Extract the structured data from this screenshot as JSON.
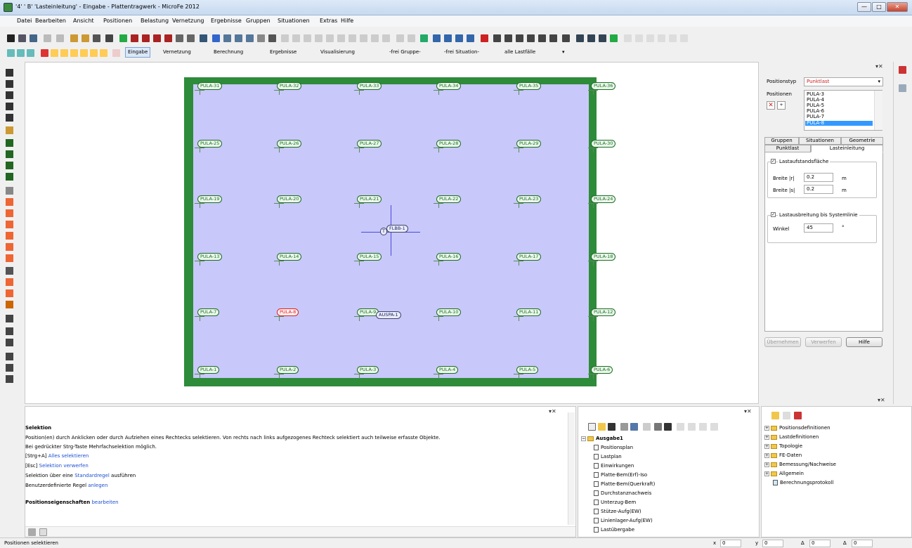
{
  "window": {
    "title": "'4' ' B' 'Lasteinleitung' - Eingabe - Plattentragwerk - MicroFe 2012",
    "min": "—",
    "max": "□",
    "close": "✕"
  },
  "menu": [
    "Datei",
    "Bearbeiten",
    "Ansicht",
    "Positionen",
    "Belastung",
    "Vernetzung",
    "Ergebnisse",
    "Gruppen",
    "Situationen",
    "Extras",
    "Hilfe"
  ],
  "toolbar3": {
    "eingabe": "Eingabe",
    "vernetzung": "Vernetzung",
    "berechnung": "Berechnung",
    "ergebnisse": "Ergebnisse",
    "visualisierung": "Visualisierung",
    "gruppe": "-frei Gruppe-",
    "situation": "-frei Situation-",
    "lastfaelle": "alle Lastfälle"
  },
  "pula": {
    "r1": [
      "PULA-31",
      "PULA-32",
      "PULA-33",
      "PULA-34",
      "PULA-35",
      "PULA-36"
    ],
    "r2": [
      "PULA-25",
      "PULA-26",
      "PULA-27",
      "PULA-28",
      "PULA-29",
      "PULA-30"
    ],
    "r3": [
      "PULA-19",
      "PULA-20",
      "PULA-21",
      "PULA-22",
      "PULA-23",
      "PULA-24"
    ],
    "r4": [
      "PULA-13",
      "PULA-14",
      "PULA-15",
      "PULA-16",
      "PULA-17",
      "PULA-18"
    ],
    "r5": [
      "PULA-7",
      "PULA-8",
      "PULA-9",
      "PULA-10",
      "PULA-11",
      "PULA-12"
    ],
    "r6": [
      "PULA-1",
      "PULA-2",
      "PULA-3",
      "PULA-4",
      "PULA-5",
      "PULA-6"
    ],
    "flbb": "FLBB-1",
    "aussp": "AUSPA-1",
    "sel_marker": "T"
  },
  "props": {
    "positionstyp_label": "Positionstyp",
    "positionstyp_value": "Punktlast",
    "positionen_label": "Positionen",
    "list": [
      "PULA-3",
      "PULA-4",
      "PULA-5",
      "PULA-6",
      "PULA-7",
      "PULA-8"
    ],
    "tabs_top": [
      "Gruppen",
      "Situationen",
      "Geometrie"
    ],
    "tabs_bottom": [
      "Punktlast",
      "Lasteinleitung"
    ],
    "lastaufstand": "Lastaufstandsfläche",
    "breite_r_label": "Breite |r|",
    "breite_r_value": "0.2",
    "breite_s_label": "Breite |s|",
    "breite_s_value": "0.2",
    "unit_m": "m",
    "lastausbreitung": "Lastausbreitung bis Systemlinie",
    "winkel_label": "Winkel",
    "winkel_value": "45",
    "unit_deg": "°",
    "uebernehmen": "Übernehmen",
    "verwerfen": "Verwerfen",
    "hilfe": "Hilfe"
  },
  "selection": {
    "title": "Selektion",
    "line1": "Position(en) durch Anklicken oder durch Aufziehen eines Rechtecks selektieren. Von rechts nach links aufgezogenes Rechteck selektiert auch teilweise erfasste Objekte.",
    "line2": "Bei gedrückter Strg-Taste Mehrfachselektion möglich.",
    "line3_pre": "[Strg+A]",
    "line3_link": "Alles selektieren",
    "line4_pre": "[Esc]",
    "line4_link": "Selektion verwerfen",
    "line5_pre": "Selektion über eine",
    "line5_link": "Standardregel",
    "line5_post": "ausführen",
    "line6_pre": "Benutzerdefinierte Regel",
    "line6_link": "anlegen",
    "props_pre": "Positionseigenschaften",
    "props_link": "bearbeiten"
  },
  "output": {
    "root": "Ausgabe1",
    "items": [
      "Positionsplan",
      "Lastplan",
      "Einwirkungen",
      "Platte-Bem(Erf)-Iso",
      "Platte-Bem(Querkraft)",
      "Durchstanznachweis",
      "Unterzug-Bem",
      "Stütze-Aufg(EW)",
      "Linienlager-Aufg(EW)",
      "Lastübergabe"
    ]
  },
  "tree": {
    "items": [
      "Positionsdefinitionen",
      "Lastdefinitionen",
      "Topologie",
      "FE-Daten",
      "Bemessung/Nachweise",
      "Allgemein",
      "Berechnungsprotokoll"
    ]
  },
  "status": {
    "text": "Positionen selektieren",
    "f1": "0",
    "f2": "0",
    "f3": "0",
    "f4": "0"
  },
  "colors": {
    "plate": "#2e8b3a",
    "inner": "#c8c8fa",
    "label": "#1c6e26",
    "selected": "#d22222",
    "link": "#1b4fd1"
  }
}
